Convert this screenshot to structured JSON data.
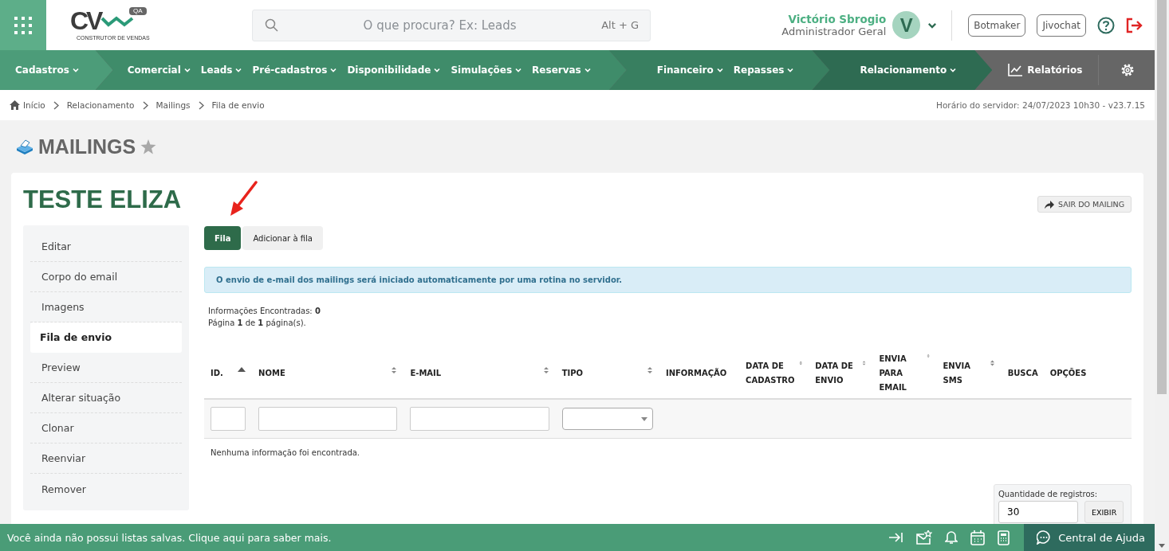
{
  "header": {
    "logo": {
      "mark": "CV",
      "badge": "QA",
      "tagline": "CONSTRUTOR DE VENDAS"
    },
    "search": {
      "placeholder": "O que procura? Ex: Leads",
      "shortcut": "Alt + G"
    },
    "user": {
      "name": "Victório Sbrogio",
      "role": "Administrador Geral",
      "initial": "V"
    },
    "buttons": [
      "Botmaker",
      "Jivochat"
    ]
  },
  "nav": {
    "groups": [
      {
        "color": "#4c9c79",
        "items": [
          "Cadastros"
        ]
      },
      {
        "color": "#3f8c6a",
        "items": [
          "Comercial",
          "Leads",
          "Pré-cadastros",
          "Disponibilidade",
          "Simulações",
          "Reservas"
        ]
      },
      {
        "color": "#387f60",
        "items": [
          "Financeiro",
          "Repasses"
        ]
      },
      {
        "color": "#2e6b52",
        "items": [
          "Relacionamento"
        ]
      }
    ],
    "reports": "Relatórios"
  },
  "breadcrumb": {
    "items": [
      "Início",
      "Relacionamento",
      "Mailings",
      "Fila de envio"
    ],
    "server_time": "Horário do servidor: 24/07/2023 10h30 - v23.7.15"
  },
  "page": {
    "title": "MAILINGS",
    "favorite": false
  },
  "mailing": {
    "title": "TESTE ELIZA",
    "exit_button": "SAIR DO MAILING"
  },
  "sidebar": {
    "items": [
      {
        "label": "Editar",
        "selected": false
      },
      {
        "label": "Corpo do email",
        "selected": false
      },
      {
        "label": "Imagens",
        "selected": false
      },
      {
        "label": "Fila de envio",
        "selected": true
      },
      {
        "label": "Preview",
        "selected": false
      },
      {
        "label": "Alterar situação",
        "selected": false
      },
      {
        "label": "Clonar",
        "selected": false
      },
      {
        "label": "Reenviar",
        "selected": false
      },
      {
        "label": "Remover",
        "selected": false
      }
    ]
  },
  "tabs": [
    {
      "label": "Fila",
      "selected": true
    },
    {
      "label": "Adicionar à fila",
      "selected": false
    }
  ],
  "alert": "O envio de e-mail dos mailings será iniciado automaticamente por uma rotina no servidor.",
  "summary": {
    "found": "Informações Encontradas: **0**",
    "pages": "Página **1** de **1** página(s)."
  },
  "table": {
    "columns": [
      {
        "label": "ID.",
        "sortable": true,
        "sorted": true
      },
      {
        "label": "NOME",
        "sortable": true,
        "sorted": false
      },
      {
        "label": "E-MAIL",
        "sortable": true,
        "sorted": false
      },
      {
        "label": "TIPO",
        "sortable": true,
        "sorted": false
      },
      {
        "label": "INFORMAÇÃO",
        "sortable": false
      },
      {
        "label": "DATA DE CADASTRO",
        "sortable": true,
        "sorted": false
      },
      {
        "label": "DATA DE ENVIO",
        "sortable": true,
        "sorted": false
      },
      {
        "label": "ENVIA PARA EMAIL",
        "sortable": true,
        "sorted": false
      },
      {
        "label": "ENVIA SMS",
        "sortable": true,
        "sorted": false
      },
      {
        "label": "BUSCA",
        "sortable": false
      },
      {
        "label": "OPÇÕES",
        "sortable": false
      }
    ],
    "filters": [
      {
        "kind": "input"
      },
      {
        "kind": "input"
      },
      {
        "kind": "input"
      },
      {
        "kind": "select"
      }
    ],
    "empty_message": "Nenhuma informação foi encontrada."
  },
  "page_size": {
    "label": "Quantidade de registros:",
    "value": "30",
    "button": "EXIBIR"
  },
  "footer": {
    "message": "Você ainda não possui listas salvas. Clique aqui para saber mais.",
    "help": "Central de Ajuda"
  }
}
